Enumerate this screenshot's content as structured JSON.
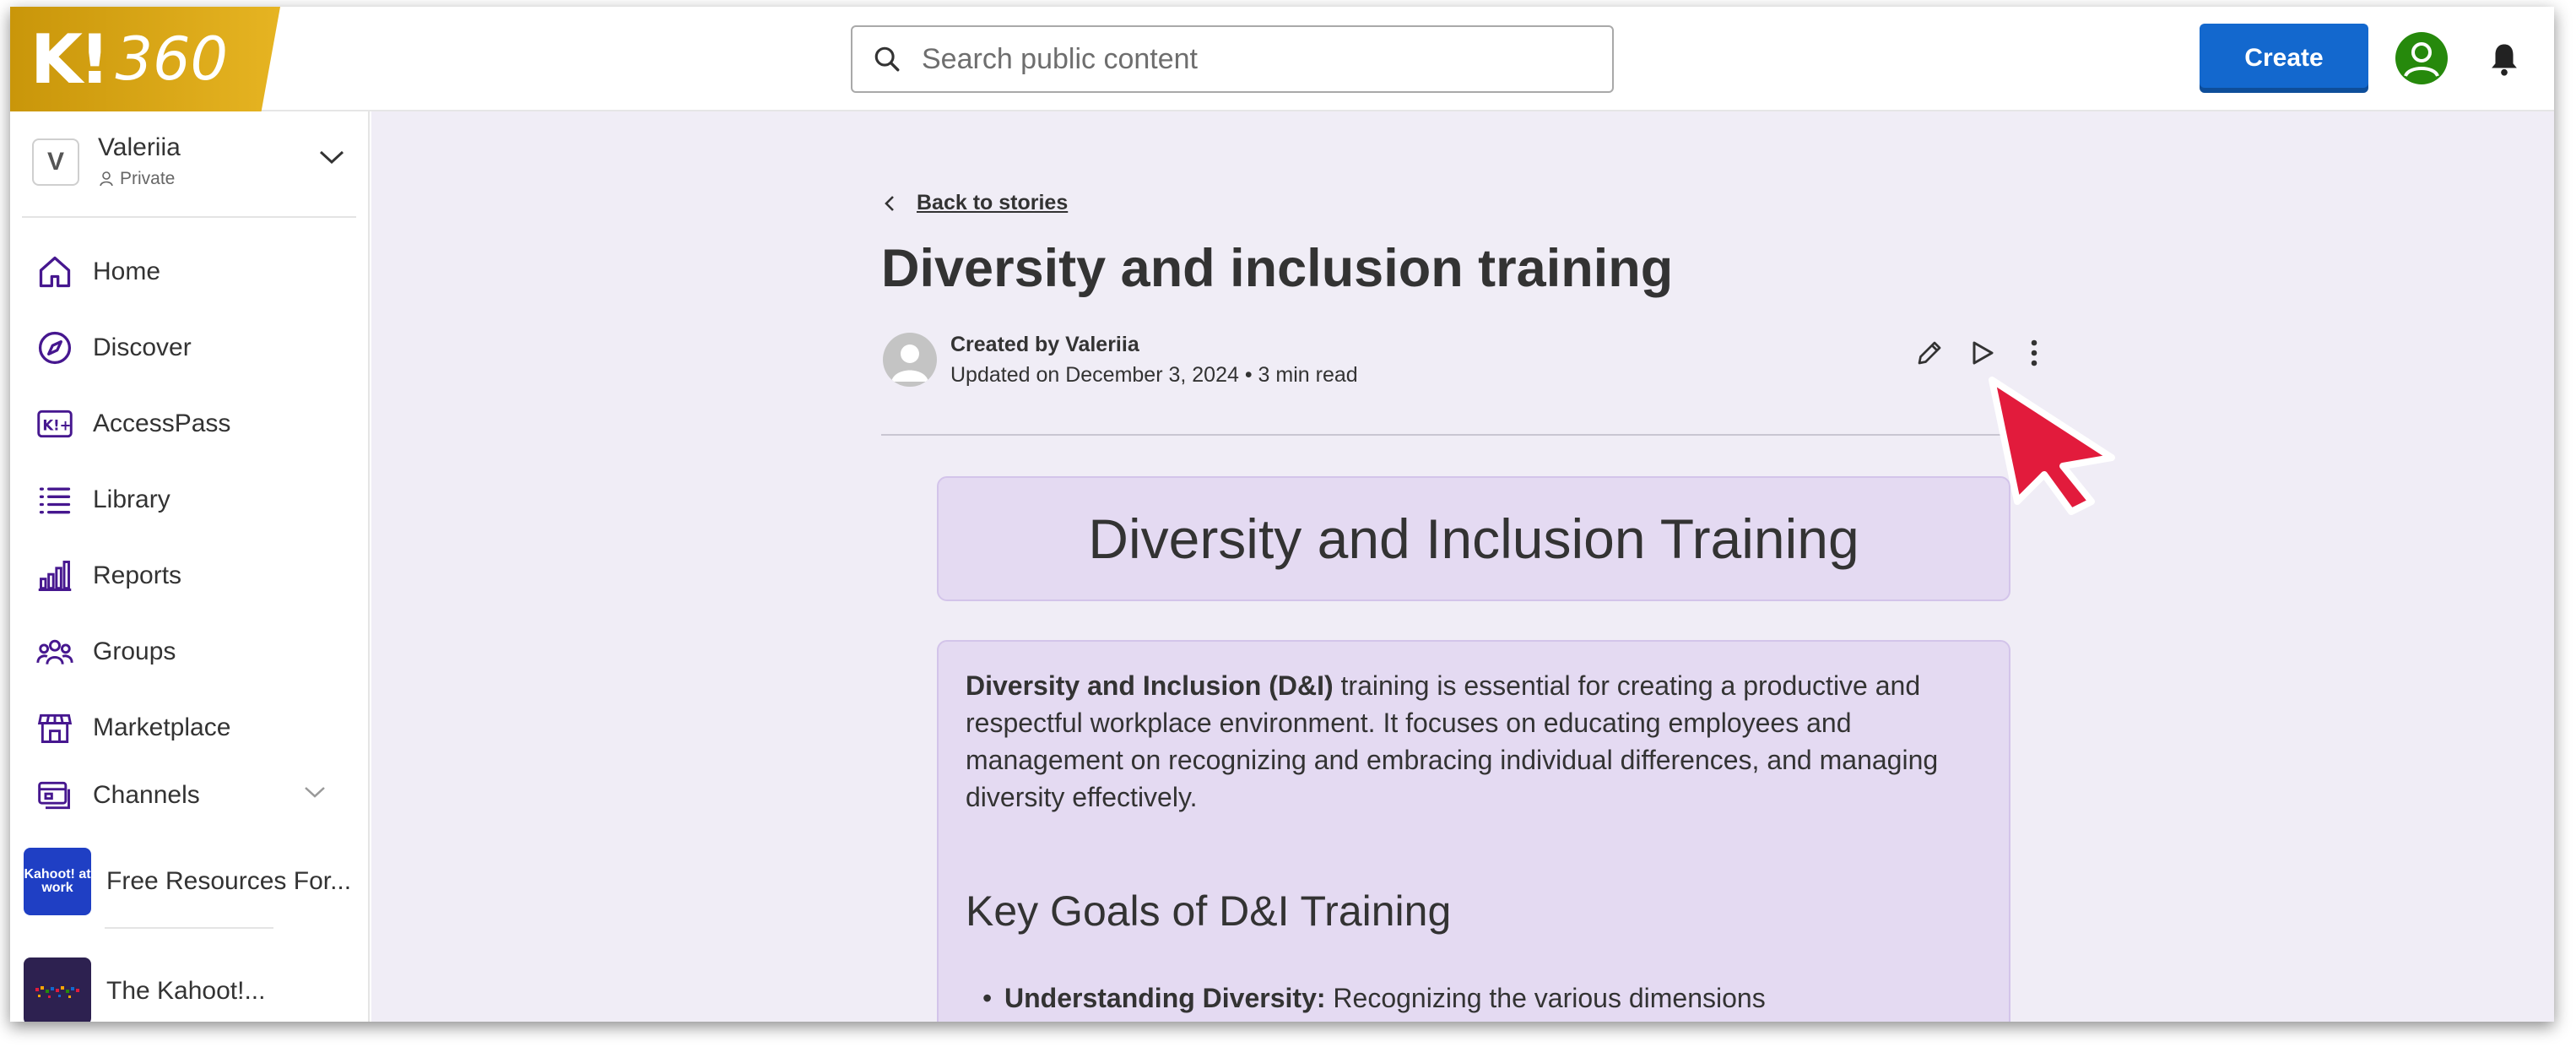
{
  "brand": {
    "logo_k": "K!",
    "logo_num": "360"
  },
  "header": {
    "search_placeholder": "Search public content",
    "create_label": "Create",
    "profile_icon": "user-avatar-icon",
    "notifications_icon": "bell-icon"
  },
  "sidebar": {
    "workspace": {
      "initial": "V",
      "name": "Valeriia",
      "visibility": "Private"
    },
    "items": [
      {
        "label": "Home",
        "icon": "home-icon"
      },
      {
        "label": "Discover",
        "icon": "compass-icon"
      },
      {
        "label": "AccessPass",
        "icon": "accesspass-icon"
      },
      {
        "label": "Library",
        "icon": "list-icon"
      },
      {
        "label": "Reports",
        "icon": "bar-chart-icon"
      },
      {
        "label": "Groups",
        "icon": "group-icon"
      },
      {
        "label": "Marketplace",
        "icon": "store-icon"
      },
      {
        "label": "Channels",
        "icon": "channels-icon"
      }
    ],
    "channels": [
      {
        "label": "Free Resources For...",
        "thumb_text": "Kahoot! at work",
        "thumb_color": "#1f3fc4"
      },
      {
        "label": "The Kahoot!...",
        "thumb_text": "",
        "thumb_color": "#2d2150"
      }
    ]
  },
  "story": {
    "back_label": "Back to stories",
    "title": "Diversity and inclusion training",
    "created_by": "Created by Valeriia",
    "updated": "Updated on December 3, 2024 • 3 min read",
    "actions": [
      "edit-icon",
      "play-icon",
      "more-options-icon"
    ],
    "heading_card": "Diversity and Inclusion Training",
    "intro_bold": "Diversity and Inclusion (D&I)",
    "intro_rest": " training is essential for creating a productive and respectful workplace environment. It focuses on educating employees and management on recognizing and embracing individual differences, and managing diversity effectively.",
    "section_heading": "Key Goals of D&I Training",
    "bullet_bold": "Understanding Diversity:",
    "bullet_rest": " Recognizing the various dimensions"
  },
  "colors": {
    "brand_gold": "#e6b422",
    "create_blue": "#1368ce",
    "nav_icon_purple": "#46178f",
    "card_lavender": "#e4daf2",
    "cursor_red": "#e21b3c"
  }
}
